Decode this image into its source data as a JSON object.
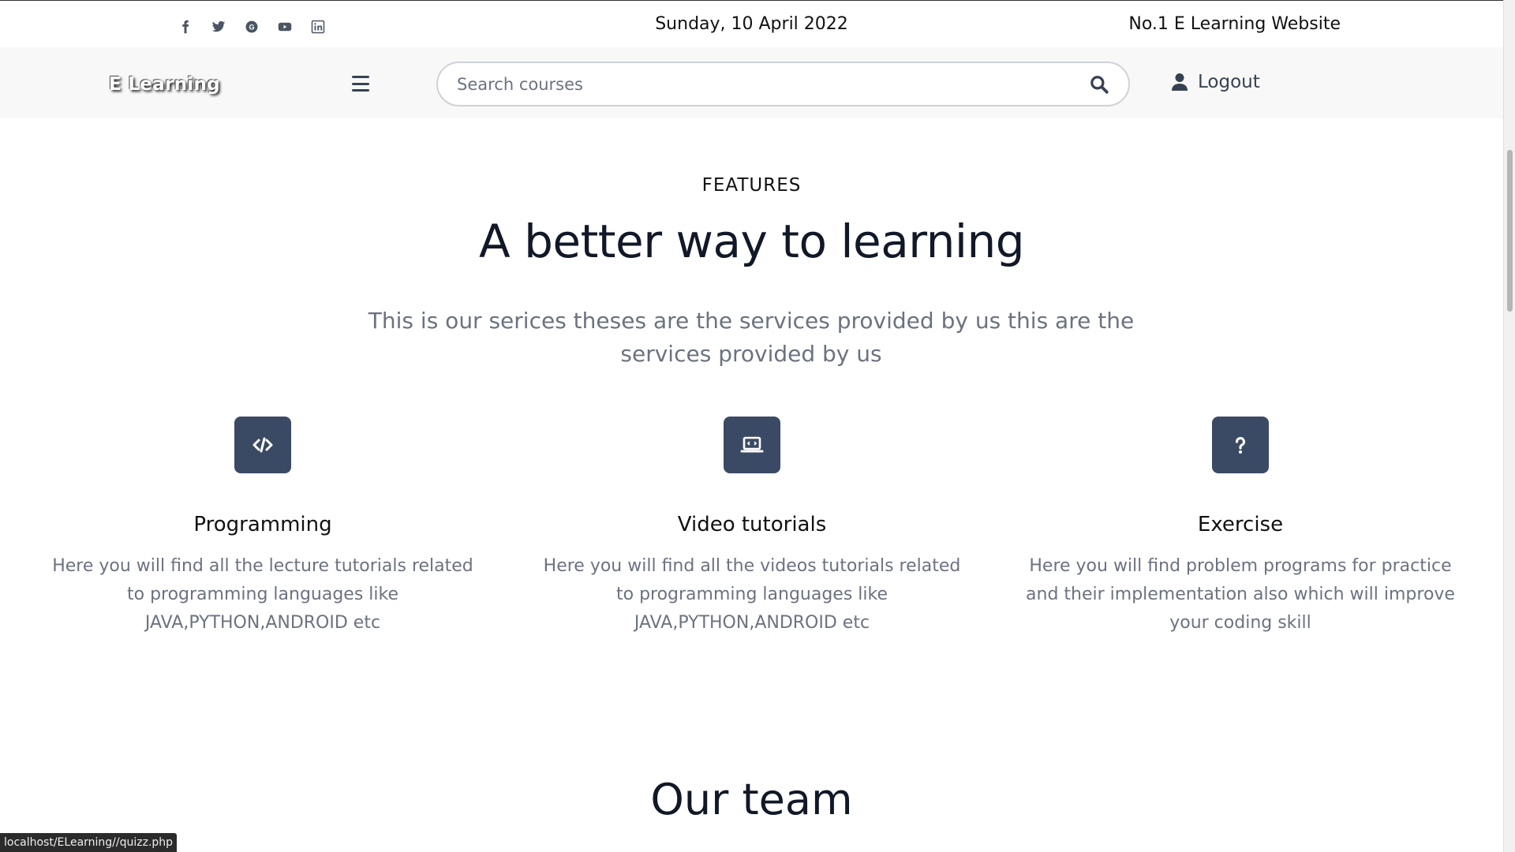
{
  "topbar": {
    "socials": [
      "facebook-icon",
      "twitter-icon",
      "google-plus-icon",
      "youtube-icon",
      "linkedin-icon"
    ],
    "date": "Sunday, 10 April 2022",
    "tagline": "No.1 E Learning Website"
  },
  "navbar": {
    "logo": "E Learning",
    "search_placeholder": "Search courses",
    "logout_label": "Logout"
  },
  "features": {
    "kicker": "FEATURES",
    "headline": "A better way to learning",
    "subtext": "This is our serices theses are the services provided by us this are the services provided by us",
    "items": [
      {
        "icon": "code-icon",
        "title": "Programming",
        "description": "Here you will find all the lecture tutorials related to programming languages like JAVA,PYTHON,ANDROID etc"
      },
      {
        "icon": "laptop-code-icon",
        "title": "Video tutorials",
        "description": "Here you will find all the videos tutorials related to programming languages like JAVA,PYTHON,ANDROID etc"
      },
      {
        "icon": "question-icon",
        "title": "Exercise",
        "description": "Here you will find problem programs for practice and their implementation also which will improve your coding skill"
      }
    ]
  },
  "team": {
    "heading": "Our team"
  },
  "status_bar": {
    "url": "localhost/ELearning//quizz.php"
  },
  "colors": {
    "icon_tile": "#3b4a64",
    "muted_text": "#6b7280",
    "heading": "#111827"
  }
}
